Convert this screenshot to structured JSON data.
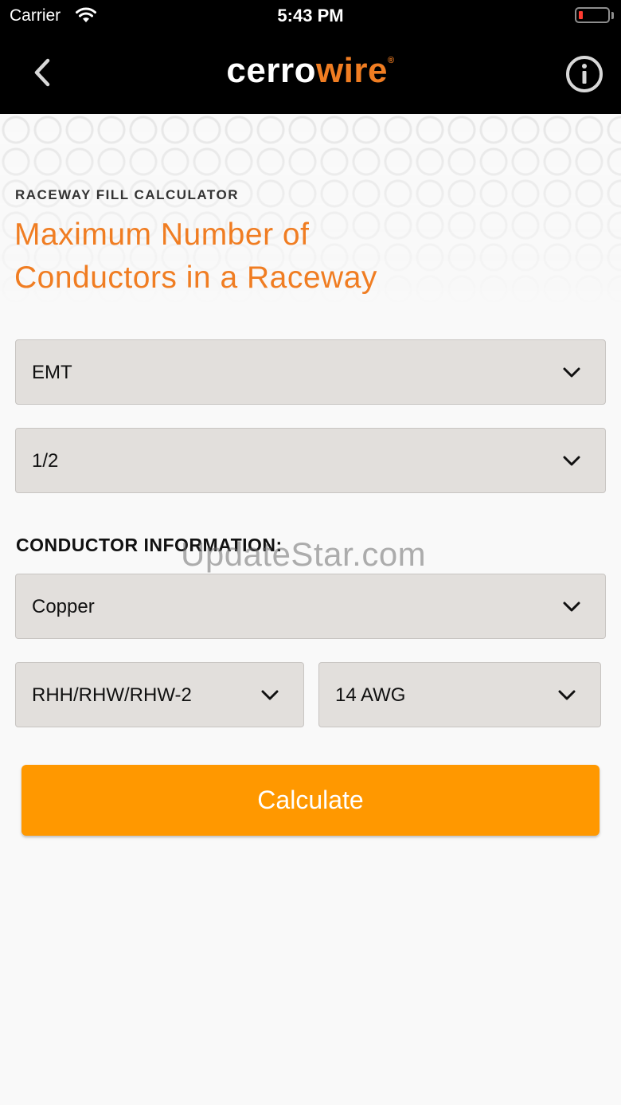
{
  "status_bar": {
    "carrier": "Carrier",
    "time": "5:43 PM"
  },
  "nav": {
    "logo_part1": "cerro",
    "logo_part2": "wire",
    "logo_mark": "®",
    "back_icon": "chevron-left-icon",
    "info_icon": "info-icon"
  },
  "page": {
    "subtitle": "RACEWAY FILL CALCULATOR",
    "heading_line1": "Maximum Number of",
    "heading_line2": "Conductors in a Raceway"
  },
  "raceway": {
    "type_value": "EMT",
    "size_value": "1/2"
  },
  "conductor": {
    "section_label": "CONDUCTOR INFORMATION:",
    "material_value": "Copper",
    "insulation_value": "RHH/RHW/RHW-2",
    "gauge_value": "14 AWG"
  },
  "actions": {
    "calculate_label": "Calculate"
  },
  "watermark": "UpdateStar.com",
  "colors": {
    "accent": "#f07d22",
    "button": "#ff9800",
    "select_bg": "#e2dfdc",
    "topbar": "#000000"
  }
}
